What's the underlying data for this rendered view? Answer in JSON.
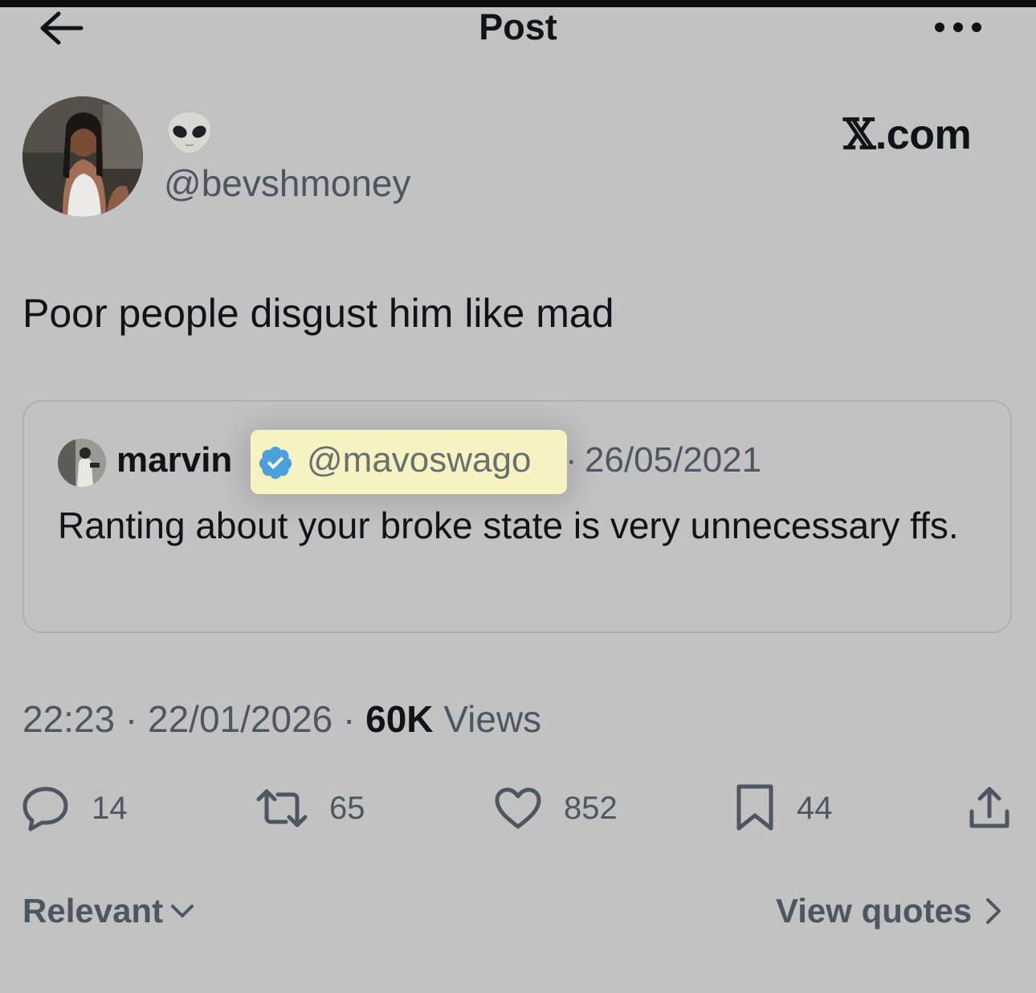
{
  "header": {
    "title": "Post",
    "back_icon": "arrow-left-icon",
    "more_icon": "more-horizontal-icon"
  },
  "post": {
    "author_display_emoji": "👽",
    "author_handle": "@bevshmoney",
    "brand": "X.com",
    "text": "Poor people disgust him like mad",
    "timestamp_time": "22:23",
    "timestamp_date": "22/01/2026",
    "views_count": "60K",
    "views_label": "Views"
  },
  "quote": {
    "name": "marvin",
    "handle": "@mavoswago",
    "separator": "·",
    "date": "26/05/2021",
    "text": "Ranting about your broke state is very unnecessary ffs.",
    "verified_color": "#4a9fdc",
    "highlight_color": "#f6f2c1"
  },
  "actions": {
    "replies": "14",
    "reposts": "65",
    "likes": "852",
    "bookmarks": "44"
  },
  "footer": {
    "sort_label": "Relevant",
    "view_quotes_label": "View quotes"
  },
  "colors": {
    "background": "#c2c2c2",
    "text_primary": "#0f1419",
    "text_secondary": "#4d5761"
  }
}
